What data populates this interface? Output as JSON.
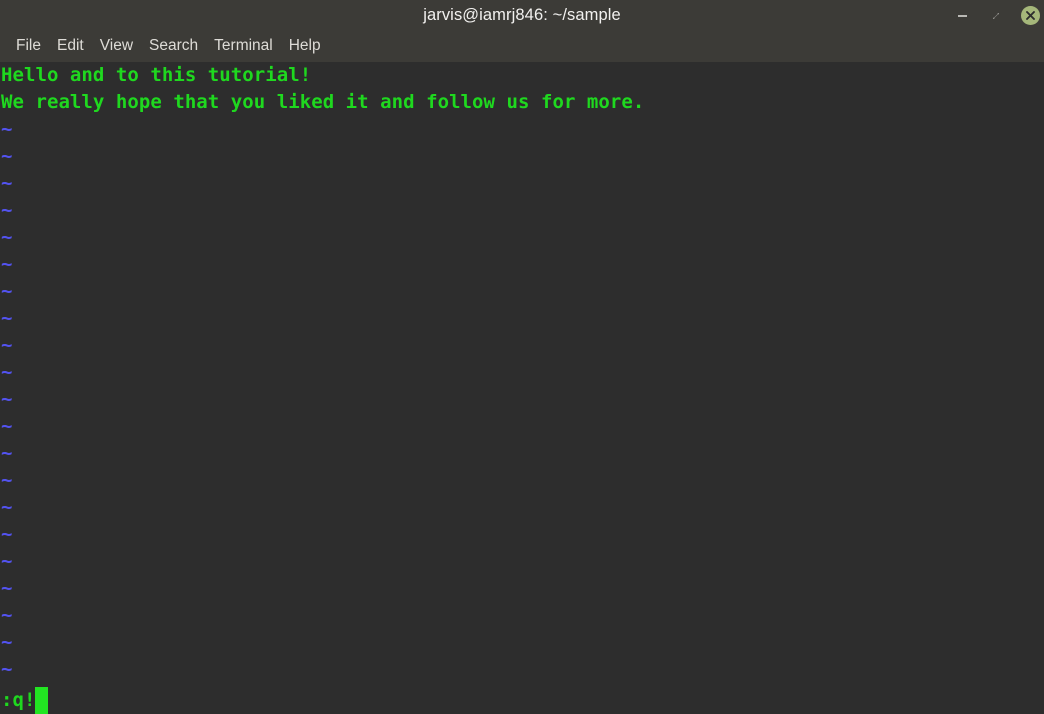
{
  "window": {
    "title": "jarvis@iamrj846: ~/sample",
    "controls": {
      "minimize_label": "Minimize",
      "minimize_icon": "minus-icon",
      "maximize_label": "Maximize",
      "maximize_icon": "restore-icon",
      "close_label": "Close",
      "close_icon": "close-x-icon",
      "close_color": "#a5b77a"
    },
    "titlebar_color": "#3c3b37"
  },
  "menubar": {
    "items": [
      {
        "label": "File",
        "name": "menu-item-file"
      },
      {
        "label": "Edit",
        "name": "menu-item-edit"
      },
      {
        "label": "View",
        "name": "menu-item-view"
      },
      {
        "label": "Search",
        "name": "menu-item-search"
      },
      {
        "label": "Terminal",
        "name": "menu-item-terminal"
      },
      {
        "label": "Help",
        "name": "menu-item-help"
      }
    ]
  },
  "terminal": {
    "background_color": "#2d2d2d",
    "text_color": "#1fd81f",
    "tilde_color": "#5353f0",
    "cursor_color": "#22e522",
    "editor": "vim",
    "buffer_lines": [
      "Hello and to this tutorial!",
      "We really hope that you liked it and follow us for more."
    ],
    "empty_line_marker": "~",
    "empty_line_count": 21,
    "command_line": ":q!"
  }
}
